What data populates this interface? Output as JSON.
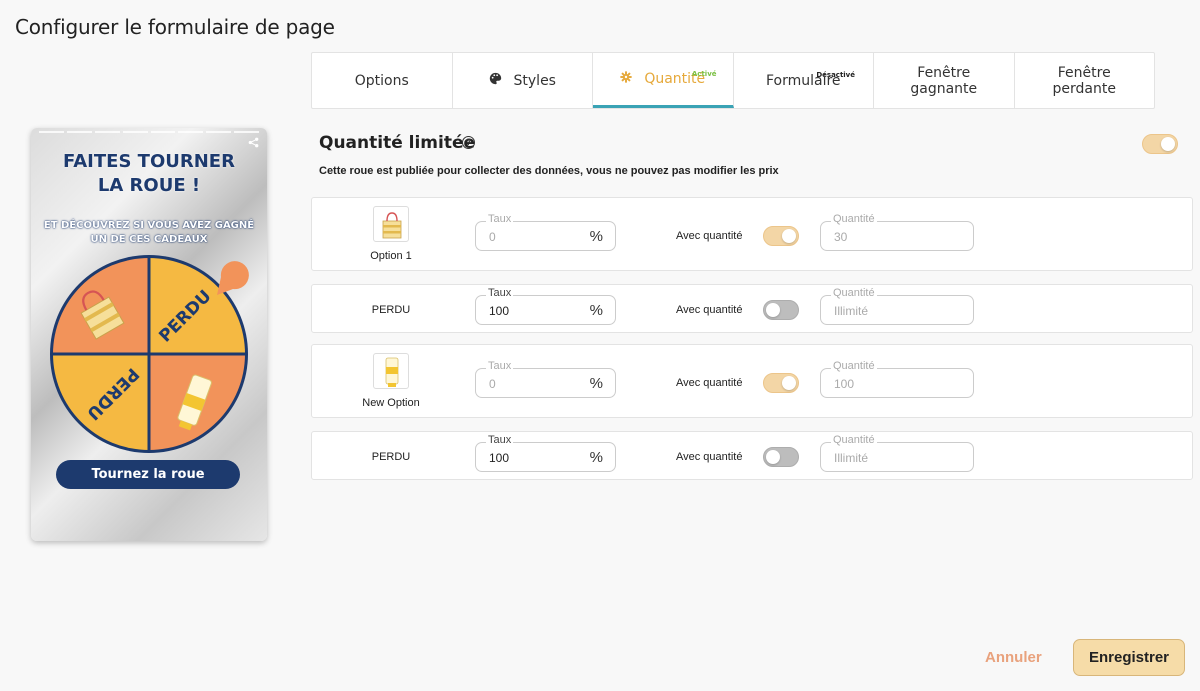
{
  "dialog": {
    "title": "Configurer le formulaire de page"
  },
  "tabs": [
    {
      "label": "Options",
      "icon": "",
      "badge": ""
    },
    {
      "label": "Styles",
      "icon": "palette-icon",
      "badge": ""
    },
    {
      "label": "Quantité",
      "icon": "gear-icon",
      "badge": "Activé"
    },
    {
      "label": "Formulaire",
      "icon": "",
      "badge": "Désactivé"
    },
    {
      "label": "Fenêtre\ngagnante",
      "icon": "",
      "badge": ""
    },
    {
      "label": "Fenêtre\nperdante",
      "icon": "",
      "badge": ""
    }
  ],
  "preview": {
    "title": "FAITES TOURNER\nLA ROUE !",
    "subtitle": "ET DÉCOUVREZ SI VOUS AVEZ GAGNÉ\nUN DE CES CADEAUX",
    "wheel_segments": [
      "",
      "PERDU",
      "PERDU",
      ""
    ],
    "button": "Tournez la roue",
    "colors": {
      "navy": "#1d3a6e",
      "orange": "#f2935a",
      "yellow": "#f5b942"
    }
  },
  "section": {
    "title": "Quantité limitée",
    "note": "Cette roue est publiée pour collecter des données, vous ne pouvez pas modifier les prix",
    "enabled": true
  },
  "labels": {
    "rate": "Taux",
    "quantity": "Quantité",
    "with_quantity": "Avec quantité",
    "percent": "%"
  },
  "rows": [
    {
      "name": "Option 1",
      "has_image": true,
      "rate": "0",
      "with_quantity": true,
      "quantity": "30"
    },
    {
      "name": "PERDU",
      "has_image": false,
      "rate": "100",
      "with_quantity": false,
      "quantity": "Illimité"
    },
    {
      "name": "New Option",
      "has_image": true,
      "rate": "0",
      "with_quantity": true,
      "quantity": "100"
    },
    {
      "name": "PERDU",
      "has_image": false,
      "rate": "100",
      "with_quantity": false,
      "quantity": "Illimité"
    }
  ],
  "footer": {
    "cancel": "Annuler",
    "save": "Enregistrer"
  },
  "accent": {
    "tab_active": "#e6a93b",
    "tab_underline": "#3aa3b5",
    "toggle_on": "#f3d6a6"
  }
}
